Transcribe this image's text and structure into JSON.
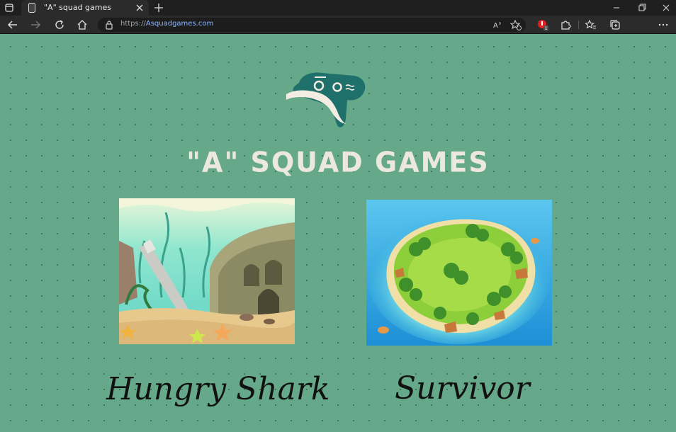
{
  "browser": {
    "tab_title": "\"A\" squad games",
    "url_scheme": "https://",
    "url_host": "Asquadgames.com",
    "extension_badge": "1"
  },
  "site": {
    "title": "\"A\" SQUAD GAMES",
    "logo_icon": "gamepad-icon"
  },
  "games": [
    {
      "name": "Hungry Shark",
      "thumbnail": "underwater-ruins-image"
    },
    {
      "name": "Survivor",
      "thumbnail": "tropical-island-image"
    }
  ],
  "colors": {
    "page_background": "#65a98a",
    "title_text": "#ece8df",
    "logo_teal": "#1f6f6a"
  }
}
